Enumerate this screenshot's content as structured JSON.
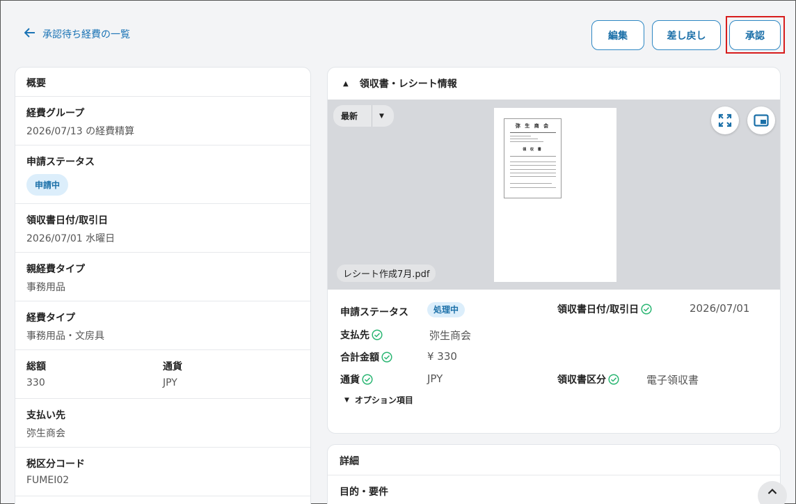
{
  "header": {
    "back_label": "承認待ち経費の一覧",
    "edit_label": "編集",
    "return_label": "差し戻し",
    "approve_label": "承認"
  },
  "overview": {
    "title": "概要",
    "expense_group": {
      "label": "経費グループ",
      "value": "2026/07/13 の経費精算"
    },
    "status": {
      "label": "申請ステータス",
      "value": "申請中"
    },
    "receipt_date": {
      "label": "領収書日付/取引日",
      "value": "2026/07/01 水曜日"
    },
    "parent_type": {
      "label": "親経費タイプ",
      "value": "事務用品"
    },
    "expense_type": {
      "label": "経費タイプ",
      "value": "事務用品・文房具"
    },
    "total": {
      "label": "総額",
      "value": "330"
    },
    "currency": {
      "label": "通貨",
      "value": "JPY"
    },
    "payee": {
      "label": "支払い先",
      "value": "弥生商会"
    },
    "tax_code": {
      "label": "税区分コード",
      "value": "FUMEI02"
    }
  },
  "receipt_panel": {
    "title": "領収書・レシート情報",
    "version_label": "最新",
    "file_name": "レシート作成7月.pdf",
    "preview": {
      "shop_name": "弥 生 商 会",
      "doc_title": "領 収 書"
    },
    "fields": {
      "status_label": "申請ステータス",
      "status_value": "処理中",
      "date_label": "領収書日付/取引日",
      "date_value": "2026/07/01",
      "payee_label": "支払先",
      "payee_value": "弥生商会",
      "amount_label": "合計金額",
      "amount_value": "¥ 330",
      "currency_label": "通貨",
      "currency_value": "JPY",
      "receipt_type_label": "領収書区分",
      "receipt_type_value": "電子領収書"
    },
    "options_label": "オプション項目"
  },
  "details": {
    "title": "詳細",
    "purpose_label": "目的・要件"
  },
  "colors": {
    "accent": "#1a73b5",
    "check_green": "#2bb673",
    "highlight_red": "#d71c1c"
  }
}
